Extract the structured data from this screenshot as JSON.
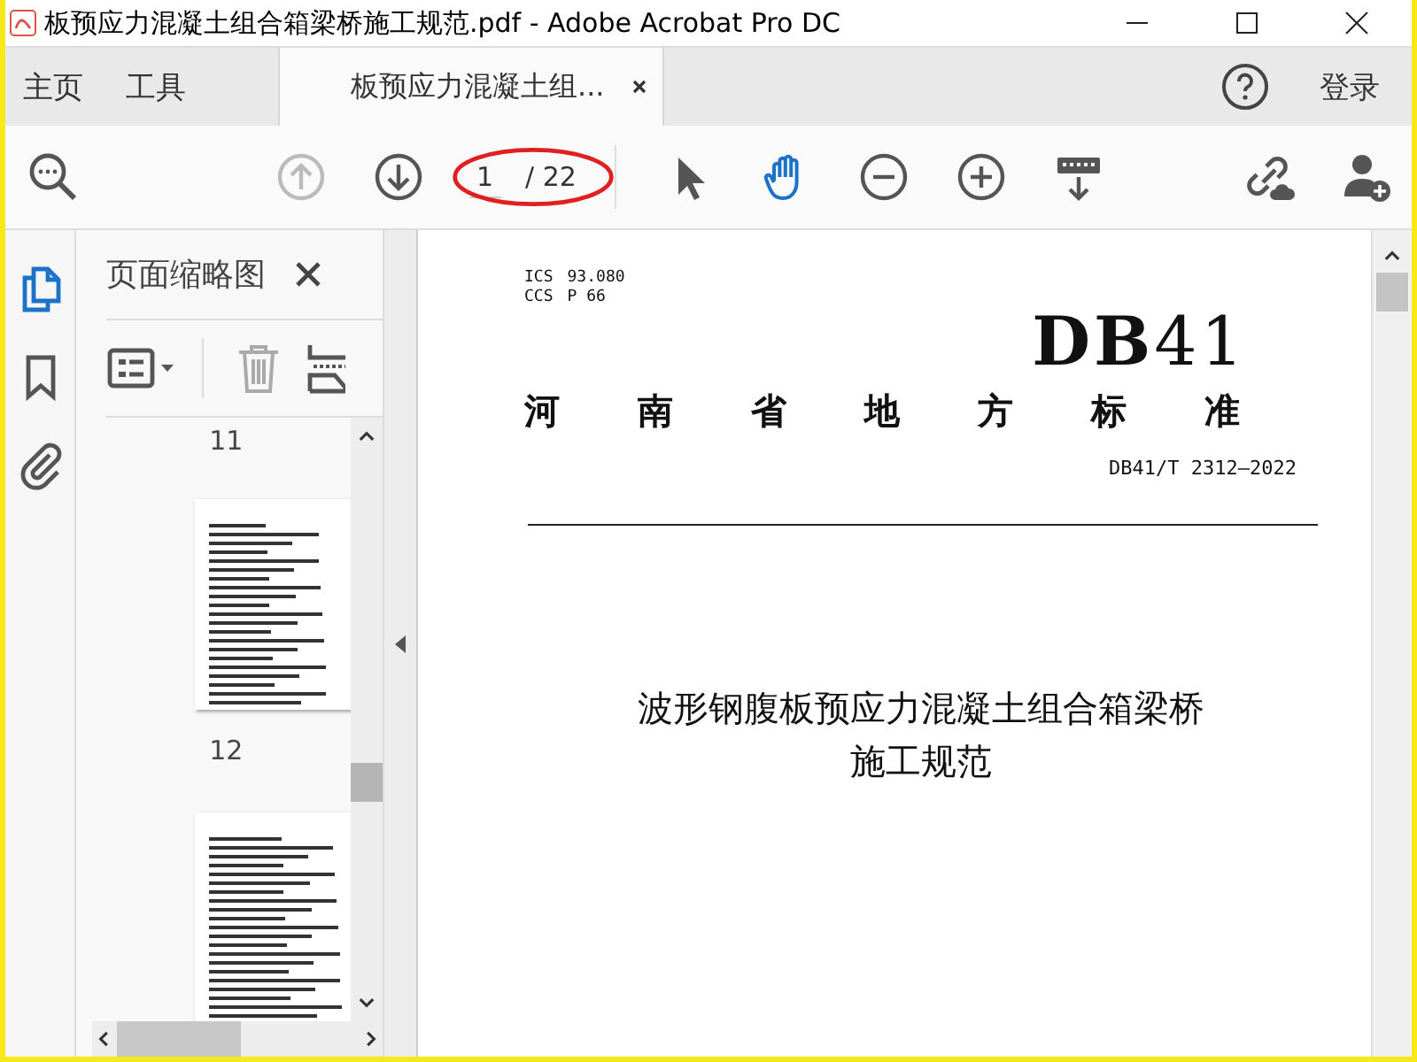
{
  "window": {
    "title": "板预应力混凝土组合箱梁桥施工规范.pdf - Adobe Acrobat Pro DC"
  },
  "tabs": [
    {
      "kind": "nav",
      "label": "主页",
      "selected": false
    },
    {
      "kind": "nav",
      "label": "工具",
      "selected": false
    },
    {
      "kind": "document",
      "label": "板预应力混凝土组...",
      "selected": true
    }
  ],
  "account": {
    "label": "登录"
  },
  "toolbar": {
    "page_current": "1",
    "page_total": "/ 22",
    "previous_disabled": true,
    "hand_tool_selected": true
  },
  "sidebar": {
    "items": [
      {
        "kind": "thumbnails",
        "selected": true
      },
      {
        "kind": "bookmarks",
        "selected": false
      },
      {
        "kind": "attachments",
        "selected": false
      }
    ]
  },
  "thumbnails_panel": {
    "title": "页面缩略图",
    "page_labels": [
      "11",
      "12"
    ]
  },
  "document": {
    "ics_label": "ICS",
    "ics_value": "93.080",
    "ccs_label": "CCS",
    "ccs_value": "P 66",
    "code_mark": "**DB**41",
    "authority": "河南省地方标准",
    "standard_number": "DB41/T 2312—2022",
    "title_lines": [
      "波形钢腹板预应力混凝土组合箱梁桥",
      "施工规范"
    ]
  }
}
